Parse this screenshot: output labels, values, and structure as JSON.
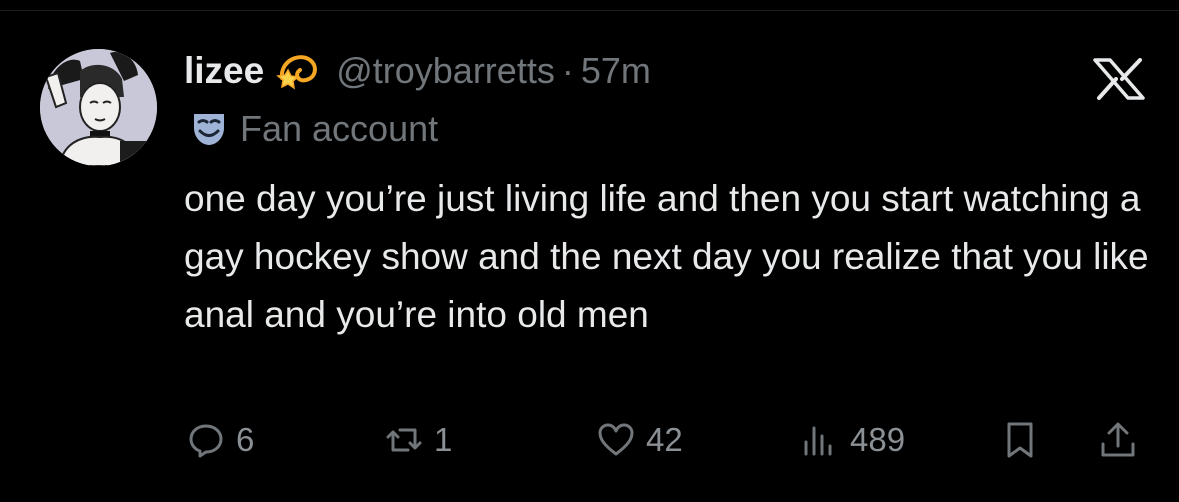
{
  "post": {
    "display_name": "lizee",
    "name_emoji": "dizzy-emoji",
    "handle": "@troybarretts",
    "separator": "·",
    "time": "57m",
    "label": "Fan account",
    "label_icon": "performing-arts-mask-icon",
    "text": "one day you’re just living life and then you start watching a gay hockey show and the next day you realize that you like anal and you’re into old men"
  },
  "brand_icon": "x-logo-icon",
  "actions": {
    "replies": "6",
    "reposts": "1",
    "likes": "42",
    "views": "489"
  },
  "colors": {
    "background": "#000000",
    "text": "#e7e9ea",
    "secondary": "#71767b",
    "mask_icon": "#9eb3d6"
  }
}
